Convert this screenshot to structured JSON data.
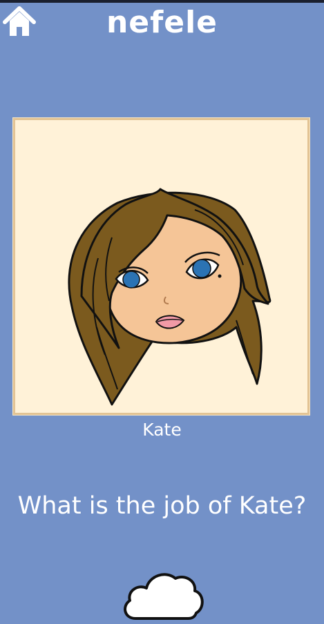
{
  "header": {
    "title": "nefele",
    "home_icon": "home-icon"
  },
  "portrait": {
    "name": "Kate",
    "image": "girl-with-brown-hair-portrait"
  },
  "question": {
    "text": "What is the job of Kate?"
  },
  "controls": {
    "cloud_icon": "cloud-icon"
  },
  "colors": {
    "background": "#7391c8",
    "frame_fill": "#fff2d8",
    "frame_border": "#e2c394",
    "text": "#ffffff"
  }
}
